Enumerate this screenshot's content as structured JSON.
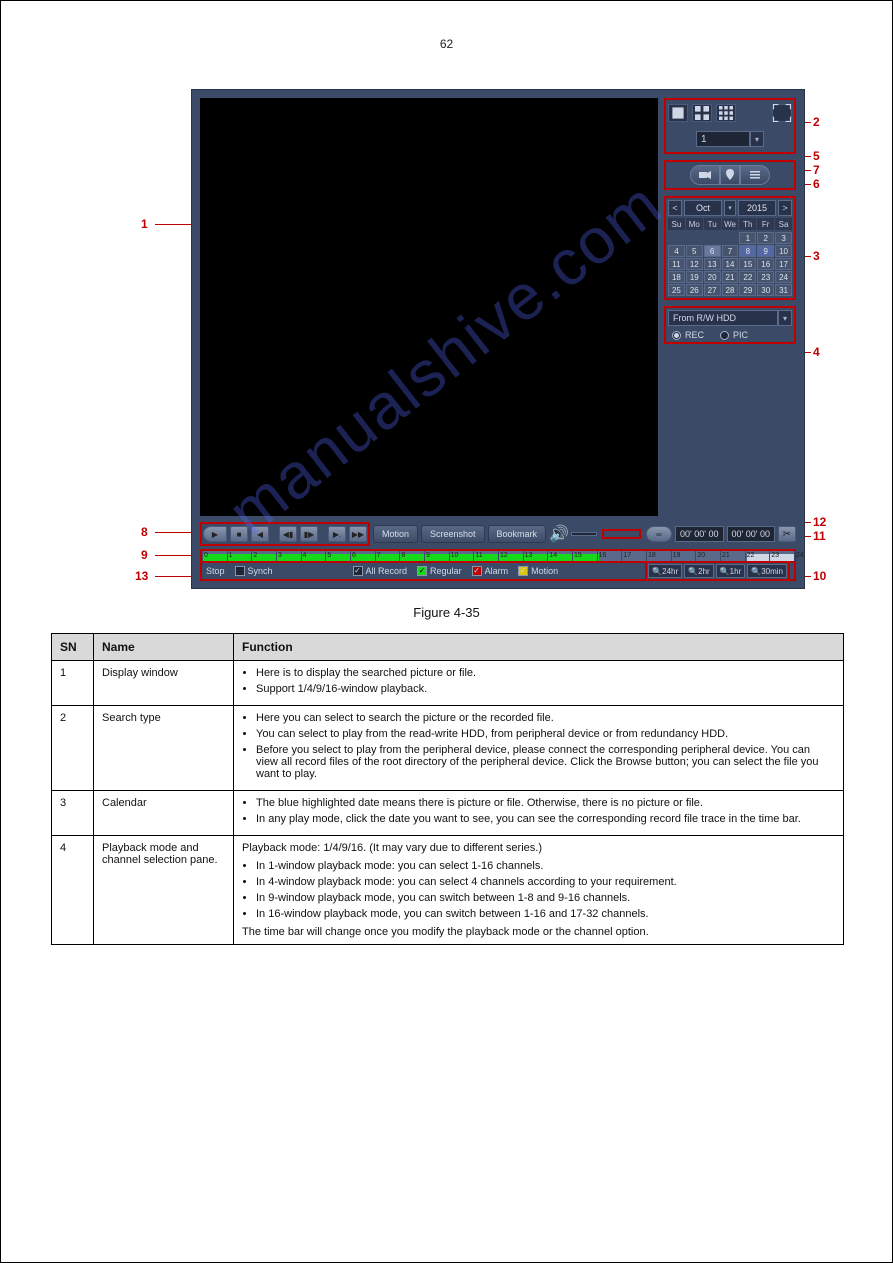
{
  "page_number": "62",
  "watermark": "manualshive.com",
  "figure_caption": "Figure 4-35",
  "app": {
    "channel_value": "1",
    "buttons": {
      "motion": "Motion",
      "screenshot": "Screenshot",
      "bookmark": "Bookmark"
    },
    "axis_label": "∞",
    "time_start": "00' 00' 00",
    "time_end": "00' 00' 00",
    "status": {
      "state": "Stop",
      "synch": "Synch",
      "all_record": "All Record",
      "regular": "Regular",
      "alarm": "Alarm",
      "motion": "Motion"
    },
    "zoom": {
      "z24": "24hr",
      "z2": "2hr",
      "z1": "1hr",
      "z30": "30min"
    },
    "calendar": {
      "month": "Oct",
      "year": "2015",
      "dayheads": [
        "Su",
        "Mo",
        "Tu",
        "We",
        "Th",
        "Fr",
        "Sa"
      ],
      "cells": [
        "",
        "",
        "",
        "",
        "1",
        "2",
        "3",
        "4",
        "5",
        "6",
        "7",
        "8",
        "9",
        "10",
        "11",
        "12",
        "13",
        "14",
        "15",
        "16",
        "17",
        "18",
        "19",
        "20",
        "21",
        "22",
        "23",
        "24",
        "25",
        "26",
        "27",
        "28",
        "29",
        "30",
        "31"
      ],
      "selected_idx": 9,
      "highlight_idx": [
        11,
        12
      ]
    },
    "source": {
      "label": "From R/W HDD",
      "rec": "REC",
      "pic": "PIC"
    },
    "timeline": {
      "hours": [
        "0",
        "1",
        "2",
        "3",
        "4",
        "5",
        "6",
        "7",
        "8",
        "9",
        "10",
        "11",
        "12",
        "13",
        "14",
        "15",
        "16",
        "17",
        "18",
        "19",
        "20",
        "21",
        "22",
        "23",
        "24"
      ],
      "rec_ranges": [
        [
          0,
          67
        ]
      ],
      "end_seg": [
        92,
        100
      ]
    }
  },
  "ann": {
    "1": "1",
    "2": "2",
    "3": "3",
    "4": "4",
    "5": "5",
    "6": "6",
    "7": "7",
    "8": "8",
    "9": "9",
    "10": "10",
    "11": "11",
    "12": "12",
    "13": "13"
  },
  "table": {
    "head": {
      "sn": "SN",
      "name": "Name",
      "fn": "Function"
    },
    "rows": [
      {
        "sn": "1",
        "name": "Display window",
        "fn_lines": [
          "Here is to display the searched picture or file.",
          "Support 1/4/9/16-window playback."
        ]
      },
      {
        "sn": "2",
        "name": "Search type",
        "fn_lines": [
          "Here you can select to search the picture or the recorded file.",
          "You can select to play from the read-write HDD, from peripheral device or from redundancy HDD.",
          "Before you select to play from the peripheral device, please connect the corresponding peripheral device. You can view all record files of the root directory of the peripheral device. Click the Browse button; you can select the file you want to play."
        ]
      },
      {
        "sn": "3",
        "name": "Calendar",
        "fn_lines": [
          "The blue highlighted date means there is picture or file. Otherwise, there is no picture or file.",
          "In any play mode, click the date you want to see, you can see the corresponding record file trace in the time bar."
        ]
      },
      {
        "sn": "4",
        "name": "Playback mode and channel selection pane.",
        "fn_html": "<div style='margin-bottom:6px;'>Playback mode: 1/4/9/16. (It may vary due to different series.)</div><ul><li>In 1-window playback mode: you can select 1-16 channels.</li><li>In 4-window playback mode: you can select 4 channels according to your requirement.</li><li>In 9-window playback mode, you can switch between 1-8 and 9-16 channels.</li><li>In 16-window playback mode, you can switch between 1-16 and 17-32 channels.</li></ul><div style='margin-top:6px;'>The time bar will change once you modify the playback mode or the channel option.</div>"
      }
    ]
  }
}
